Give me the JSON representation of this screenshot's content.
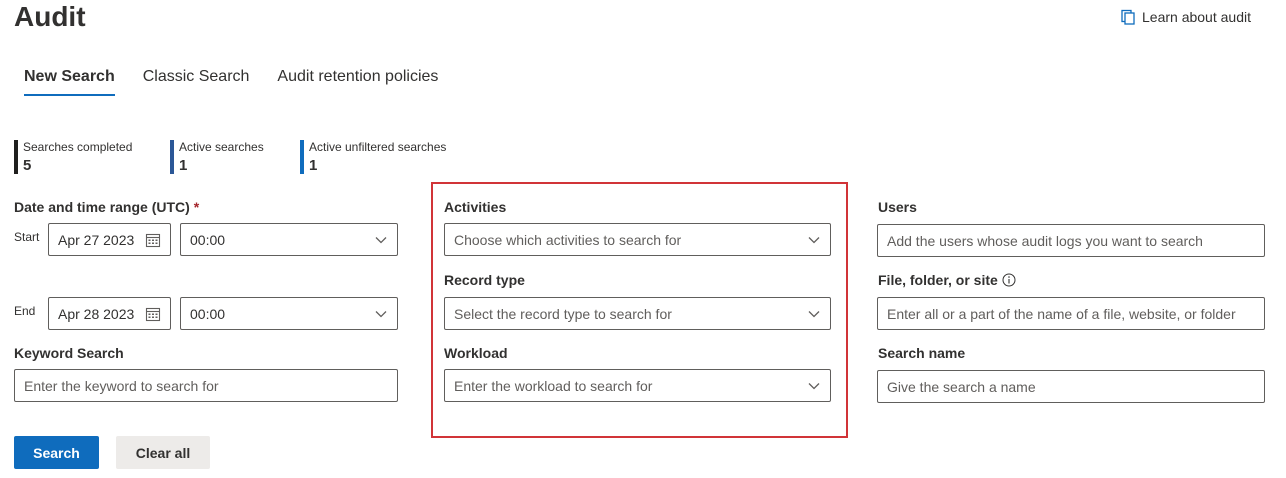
{
  "header": {
    "title": "Audit",
    "learn_link": "Learn about audit"
  },
  "tabs": [
    {
      "label": "New Search",
      "active": true
    },
    {
      "label": "Classic Search",
      "active": false
    },
    {
      "label": "Audit retention policies",
      "active": false
    }
  ],
  "stats": [
    {
      "label": "Searches completed",
      "value": "5",
      "color": "#201f1e"
    },
    {
      "label": "Active searches",
      "value": "1",
      "color": "#2b5797"
    },
    {
      "label": "Active unfiltered searches",
      "value": "1",
      "color": "#0f6cbd"
    }
  ],
  "date_range": {
    "label": "Date and time range (UTC)",
    "required_mark": "*",
    "start_label": "Start",
    "start_date": "Apr 27 2023",
    "start_time": "00:00",
    "end_label": "End",
    "end_date": "Apr 28 2023",
    "end_time": "00:00"
  },
  "keyword": {
    "label": "Keyword Search",
    "placeholder": "Enter the keyword to search for"
  },
  "activities": {
    "label": "Activities",
    "placeholder": "Choose which activities to search for"
  },
  "record_type": {
    "label": "Record type",
    "placeholder": "Select the record type to search for"
  },
  "workload": {
    "label": "Workload",
    "placeholder": "Enter the workload to search for"
  },
  "users": {
    "label": "Users",
    "placeholder": "Add the users whose audit logs you want to search"
  },
  "file_folder": {
    "label": "File, folder, or site",
    "placeholder": "Enter all or a part of the name of a file, website, or folder"
  },
  "search_name": {
    "label": "Search name",
    "placeholder": "Give the search a name"
  },
  "buttons": {
    "search": "Search",
    "clear": "Clear all"
  },
  "colors": {
    "accent": "#0f6cbd",
    "highlight": "#d13438"
  }
}
